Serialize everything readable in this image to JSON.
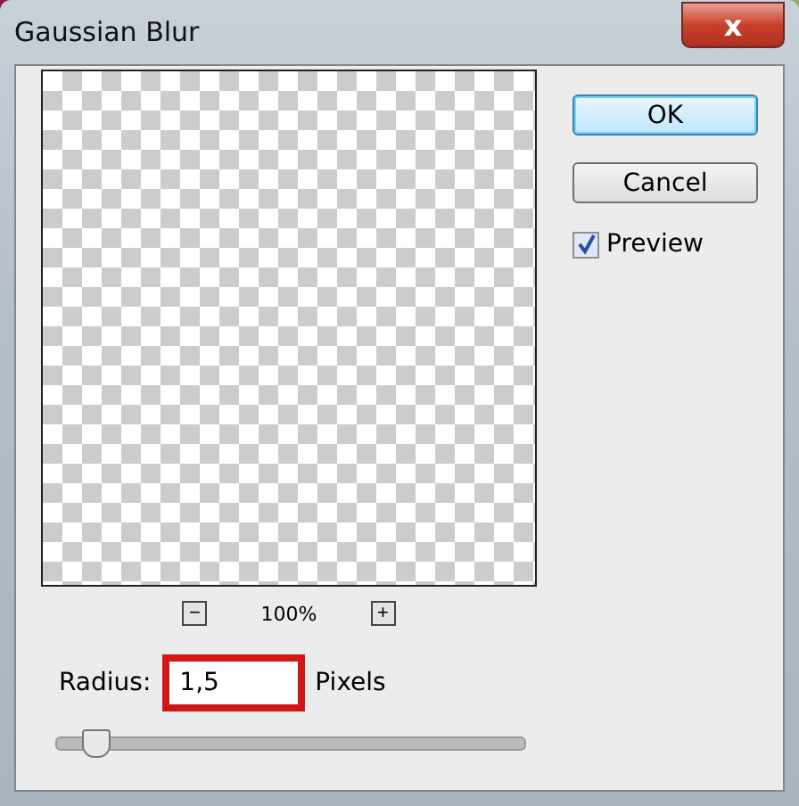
{
  "window": {
    "title": "Gaussian Blur",
    "close_label": "x"
  },
  "zoom": {
    "minus": "−",
    "value": "100%",
    "plus": "+"
  },
  "buttons": [
    {
      "label": "OK",
      "selected": true
    },
    {
      "label": "Cancel",
      "selected": false
    }
  ],
  "preview": {
    "label": "Preview",
    "checked": true
  },
  "radius": {
    "label": "Radius:",
    "value": "1,5",
    "unit": "Pixels",
    "highlighted": true,
    "level": 0.08
  }
}
